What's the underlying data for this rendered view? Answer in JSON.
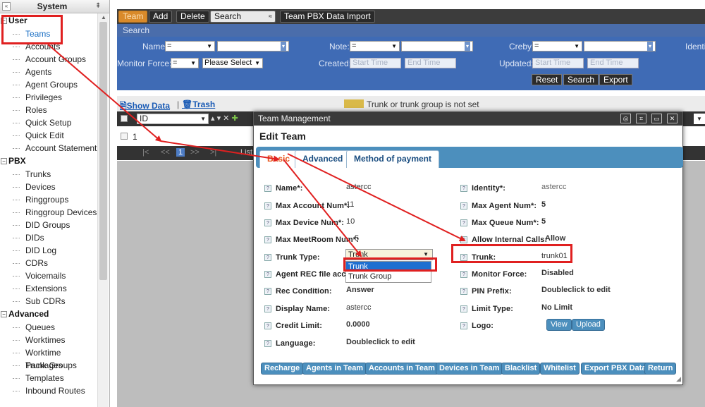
{
  "sidebar": {
    "title": "System",
    "collapse": "«",
    "groups": [
      {
        "label": "User",
        "items": [
          "Teams",
          "Accounts",
          "Account Groups",
          "Agents",
          "Agent Groups",
          "Privileges",
          "Roles",
          "Quick Setup",
          "Quick Edit",
          "Account Statement"
        ]
      },
      {
        "label": "PBX",
        "items": [
          "Trunks",
          "Devices",
          "Ringgroups",
          "Ringgroup Devices",
          "DID Groups",
          "DIDs",
          "DID Log",
          "CDRs",
          "Voicemails",
          "Extensions",
          "Sub CDRs"
        ]
      },
      {
        "label": "Advanced",
        "items": [
          "Queues",
          "Worktimes",
          "Worktime Packages",
          "Trunk Groups",
          "Templates",
          "Inbound Routes"
        ]
      }
    ]
  },
  "toolbar": {
    "team": "Team",
    "add": "Add",
    "delete": "Delete",
    "search": "Search",
    "import": "Team PBX Data Import"
  },
  "search_bar": "Search",
  "filters": {
    "name": "Name:",
    "note": "Note:",
    "creby": "Creby:",
    "identity": "Identi",
    "eq": "=",
    "monitor_force": "Monitor Force:",
    "please_select": "Please Select",
    "created": "Created:",
    "updated": "Updated:",
    "start_time": "Start Time",
    "end_time": "End Time",
    "reset": "Reset",
    "search": "Search",
    "export": "Export"
  },
  "datahead": {
    "show_data": "Show Data",
    "sep": "|",
    "trash": "Trash",
    "legend": "Trunk or trunk group is not set"
  },
  "grid": {
    "id_col": "ID",
    "row_value": "1",
    "list_label": "List",
    "page": "1"
  },
  "modal": {
    "window_title": "Team Management",
    "heading": "Edit Team",
    "tabs": [
      "Basic",
      "Advanced",
      "Method of payment"
    ],
    "left": [
      {
        "label": "Name*:",
        "value": "astercc"
      },
      {
        "label": "Max Account Num*:",
        "value": "11"
      },
      {
        "label": "Max Device Num*:",
        "value": "10"
      },
      {
        "label": "Max MeetRoom Num*:",
        "value": "5"
      },
      {
        "label": "Trunk Type:",
        "value": ""
      },
      {
        "label": "Agent REC file access:",
        "value": ""
      },
      {
        "label": "Rec Condition:",
        "value": "Answer"
      },
      {
        "label": "Display Name:",
        "value": "astercc"
      },
      {
        "label": "Credit Limit:",
        "value": "0.0000"
      },
      {
        "label": "Language:",
        "value": "Doubleclick to edit"
      }
    ],
    "right": [
      {
        "label": "Identity*:",
        "value": "astercc"
      },
      {
        "label": "Max Agent Num*:",
        "value": "5"
      },
      {
        "label": "Max Queue Num*:",
        "value": "5"
      },
      {
        "label": "Allow Internal Calls:",
        "value": "Allow"
      },
      {
        "label": "Trunk:",
        "value": "trunk01"
      },
      {
        "label": "Monitor Force:",
        "value": "Disabled"
      },
      {
        "label": "PIN Prefix:",
        "value": "Doubleclick to edit"
      },
      {
        "label": "Limit Type:",
        "value": "No Limit"
      },
      {
        "label": "Logo:",
        "value": ""
      }
    ],
    "trunk_type_selected": "Trunk",
    "trunk_type_options": [
      "Trunk",
      "Trunk Group"
    ],
    "logo_view": "View",
    "logo_upload": "Upload",
    "buttons": [
      "Recharge",
      "Agents in Team",
      "Accounts in Team",
      "Devices in Team",
      "Blacklist",
      "Whitelist",
      "Export PBX Data",
      "Return"
    ]
  },
  "colors": {
    "annotation": "#e02020",
    "tab_strip": "#4c8fbd",
    "filter_bg": "#3f6bb5",
    "highlight": "#1e6fd0",
    "legend_swatch": "#d9b949"
  }
}
